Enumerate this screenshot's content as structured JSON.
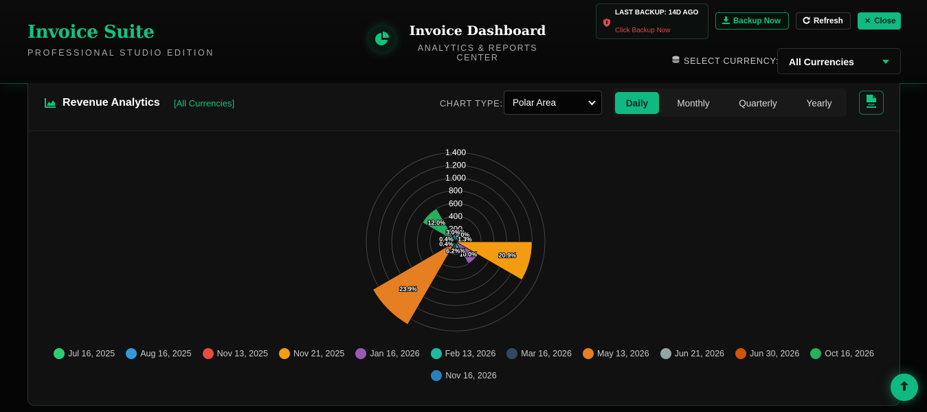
{
  "header": {
    "brand_title": "Invoice Suite",
    "brand_subtitle": "PROFESSIONAL STUDIO EDITION",
    "dashboard_title": "Invoice Dashboard",
    "dashboard_subtitle": "ANALYTICS & REPORTS CENTER",
    "backup_status": "LAST BACKUP: 14D AGO",
    "backup_link": "Click Backup Now",
    "backup_button": "Backup Now",
    "refresh_button": "Refresh",
    "close_button": "Close",
    "currency_label": "SELECT CURRENCY:",
    "currency_value": "All Currencies"
  },
  "card": {
    "title": "Revenue Analytics",
    "currency_tag": "[All Currencies]",
    "chart_type_label": "CHART TYPE:",
    "chart_type_value": "Polar Area",
    "periods": [
      "Daily",
      "Monthly",
      "Quarterly",
      "Yearly"
    ],
    "active_period": "Daily"
  },
  "colors": {
    "accent": "#10b981",
    "background": "#050505",
    "card": "#111111",
    "danger": "#e0454f"
  },
  "icons": {
    "brand": "pie-chart-icon",
    "backup_status": "shield-icon",
    "backup": "download-icon",
    "refresh": "refresh-icon",
    "close": "close-icon",
    "currency": "coins-icon",
    "analytics": "area-chart-icon",
    "pdf": "pdf-file-icon",
    "scroll_top": "arrow-up-icon"
  },
  "chart_data": {
    "type": "polar-area",
    "radial_ticks": [
      "1.400",
      "1.200",
      "1.000",
      "800",
      "600",
      "400",
      "200"
    ],
    "rmax": 1400,
    "categories": [
      "Jul 16, 2025",
      "Aug 16, 2025",
      "Nov 13, 2025",
      "Nov 21, 2025",
      "Jan 16, 2026",
      "Feb 13, 2026",
      "Mar 16, 2026",
      "May 13, 2026",
      "Jun 21, 2026",
      "Jun 30, 2026",
      "Oct 16, 2026",
      "Nov 16, 2026"
    ],
    "colors": [
      "#2ecc71",
      "#3498db",
      "#e74c3c",
      "#f39c12",
      "#9b59b6",
      "#1abc9c",
      "#34495e",
      "#e67e22",
      "#95a5a6",
      "#d35400",
      "#27ae60",
      "#2980b9"
    ],
    "values": [
      120,
      220,
      30,
      1200,
      400,
      130,
      150,
      1500,
      10,
      10,
      600,
      110
    ],
    "labels": [
      "5.0%",
      "9.0%",
      "1.3%",
      "20.9%",
      "10.0%",
      "5.5%",
      "6.2%",
      "23.9%",
      "0.4%",
      "0.4%",
      "12.0%",
      "3.0%"
    ],
    "legend_position": "bottom"
  }
}
